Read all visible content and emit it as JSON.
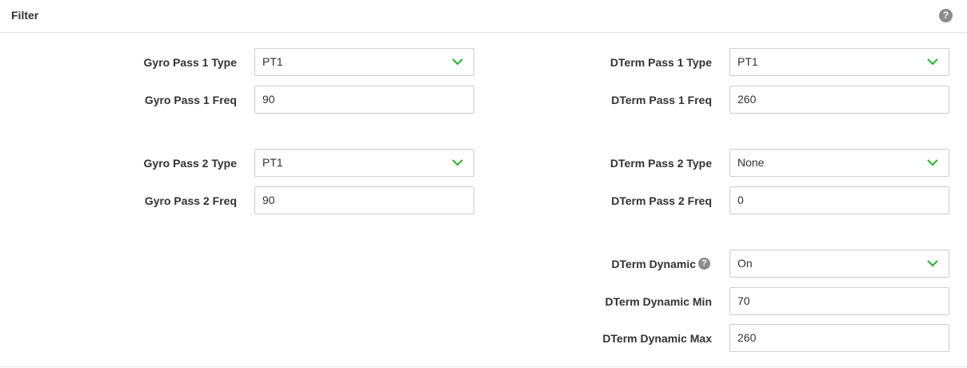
{
  "header": {
    "title": "Filter",
    "help_icon": "?"
  },
  "left": {
    "gyro_pass1_type": {
      "label": "Gyro Pass 1 Type",
      "value": "PT1"
    },
    "gyro_pass1_freq": {
      "label": "Gyro Pass 1 Freq",
      "value": "90"
    },
    "gyro_pass2_type": {
      "label": "Gyro Pass 2 Type",
      "value": "PT1"
    },
    "gyro_pass2_freq": {
      "label": "Gyro Pass 2 Freq",
      "value": "90"
    }
  },
  "right": {
    "dterm_pass1_type": {
      "label": "DTerm Pass 1 Type",
      "value": "PT1"
    },
    "dterm_pass1_freq": {
      "label": "DTerm Pass 1 Freq",
      "value": "260"
    },
    "dterm_pass2_type": {
      "label": "DTerm Pass 2 Type",
      "value": "None"
    },
    "dterm_pass2_freq": {
      "label": "DTerm Pass 2 Freq",
      "value": "0"
    },
    "dterm_dynamic": {
      "label": "DTerm Dynamic",
      "value": "On",
      "help_icon": "?"
    },
    "dterm_dynamic_min": {
      "label": "DTerm Dynamic Min",
      "value": "70"
    },
    "dterm_dynamic_max": {
      "label": "DTerm Dynamic Max",
      "value": "260"
    }
  },
  "colors": {
    "chevron": "#2bb02b",
    "help_icon_bg": "#8c8c8c",
    "border": "#cfcfcf"
  }
}
